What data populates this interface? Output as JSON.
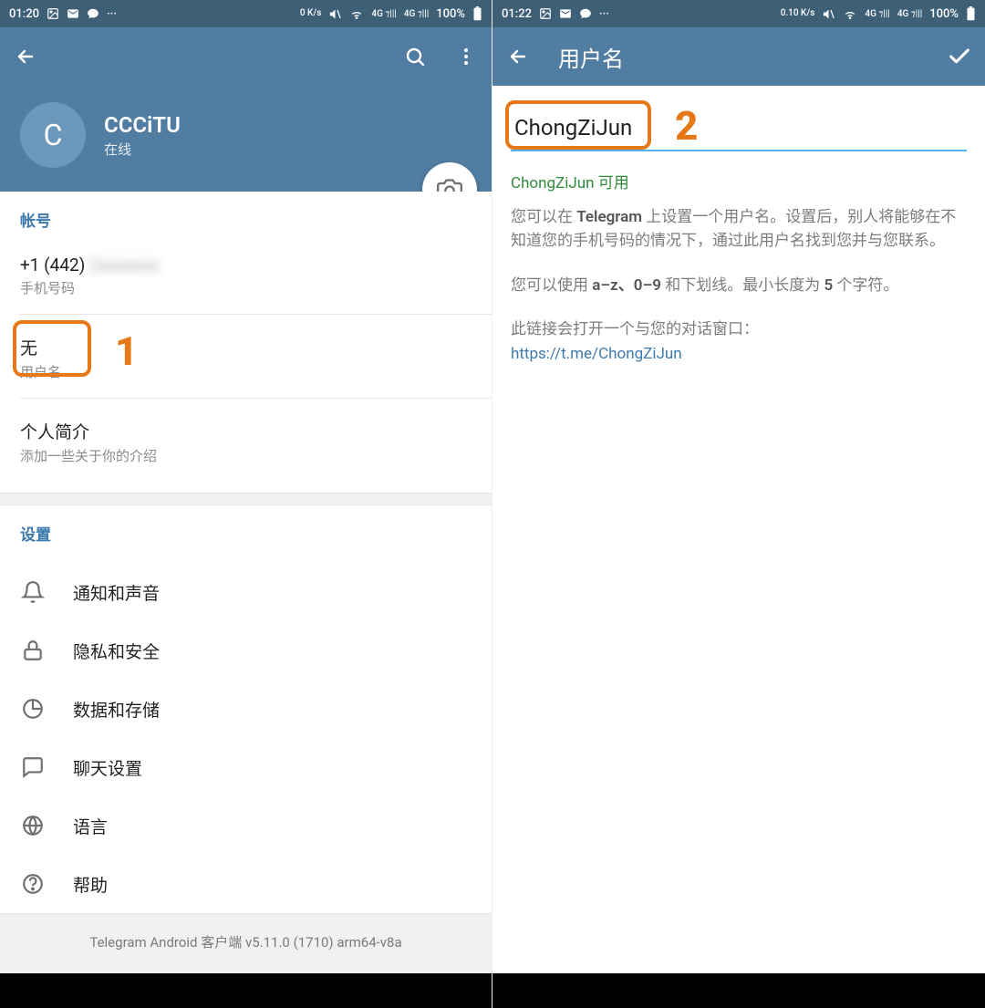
{
  "left": {
    "status": {
      "time": "01:20",
      "net": "0 K/s",
      "battery": "100%"
    },
    "profile": {
      "avatar_letter": "C",
      "name": "CCCiTU",
      "status": "在线"
    },
    "account": {
      "header": "帐号",
      "phone_prefix": "+1 (442)",
      "phone_hidden": "2xxxxxxx",
      "phone_label": "手机号码",
      "username_value": "无",
      "username_label": "用户名",
      "bio_title": "个人简介",
      "bio_hint": "添加一些关于你的介绍"
    },
    "settings": {
      "header": "设置",
      "items": [
        {
          "id": "notifications",
          "label": "通知和声音"
        },
        {
          "id": "privacy",
          "label": "隐私和安全"
        },
        {
          "id": "data",
          "label": "数据和存储"
        },
        {
          "id": "chat",
          "label": "聊天设置"
        },
        {
          "id": "language",
          "label": "语言"
        },
        {
          "id": "help",
          "label": "帮助"
        }
      ]
    },
    "footer": "Telegram Android 客户端 v5.11.0 (1710) arm64-v8a",
    "annotation": "1"
  },
  "right": {
    "status": {
      "time": "01:22",
      "net": "0.10 K/s",
      "battery": "100%"
    },
    "appbar_title": "用户名",
    "input_value": "ChongZiJun",
    "available": "ChongZiJun 可用",
    "desc1_a": "您可以在 ",
    "desc1_b": "Telegram",
    "desc1_c": " 上设置一个用户名。设置后，别人将能够在不知道您的手机号码的情况下，通过此用户名找到您并与您联系。",
    "desc2_a": "您可以使用 ",
    "desc2_b": "a–z、0–9",
    "desc2_c": " 和下划线。最小长度为 ",
    "desc2_d": "5",
    "desc2_e": " 个字符。",
    "desc3": "此链接会打开一个与您的对话窗口：",
    "link": "https://t.me/ChongZiJun",
    "annotation": "2"
  }
}
